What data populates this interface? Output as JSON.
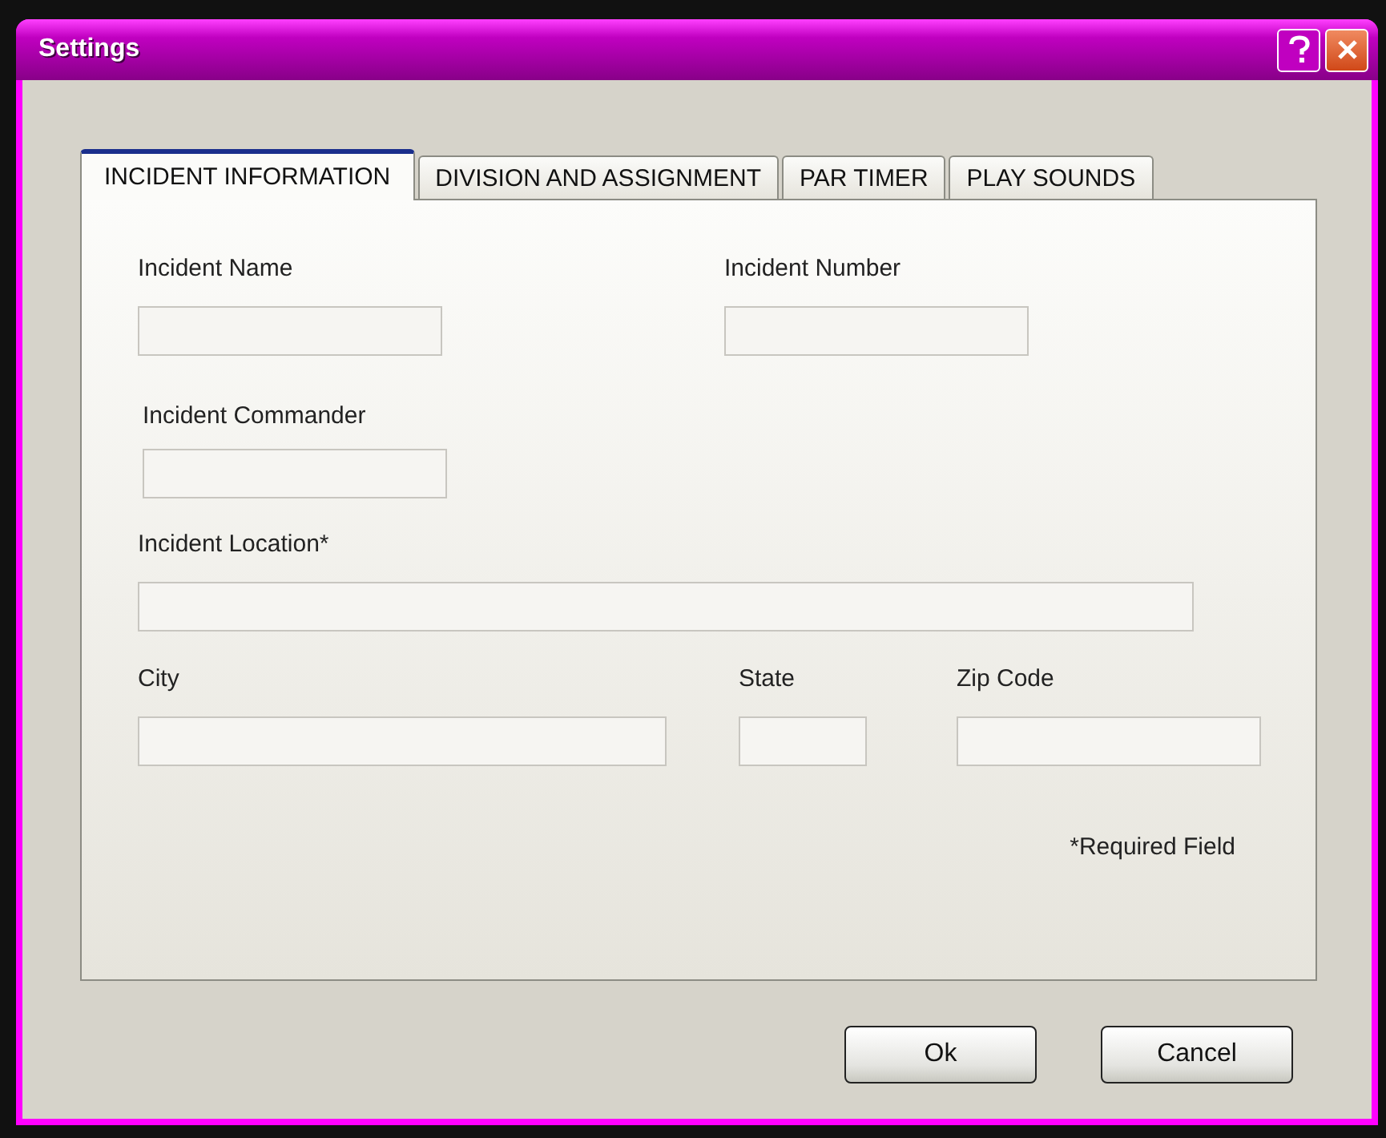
{
  "window": {
    "title": "Settings"
  },
  "tabs": [
    {
      "label": "INCIDENT INFORMATION",
      "selected": true
    },
    {
      "label": "DIVISION AND ASSIGNMENT",
      "selected": false
    },
    {
      "label": "PAR TIMER",
      "selected": false
    },
    {
      "label": "PLAY SOUNDS",
      "selected": false
    }
  ],
  "form_rows": [
    [
      {
        "label": "Incident Name"
      },
      {
        "label": "Incident Number"
      }
    ],
    [
      {
        "label": "Incident Commander"
      }
    ],
    [
      {
        "label": "Incident Location*"
      }
    ],
    [
      {
        "label": "City"
      },
      {
        "label": "State"
      },
      {
        "label": "Zip Code"
      }
    ]
  ],
  "note": "*Required Field",
  "buttons": [
    "Ok",
    "Cancel"
  ]
}
